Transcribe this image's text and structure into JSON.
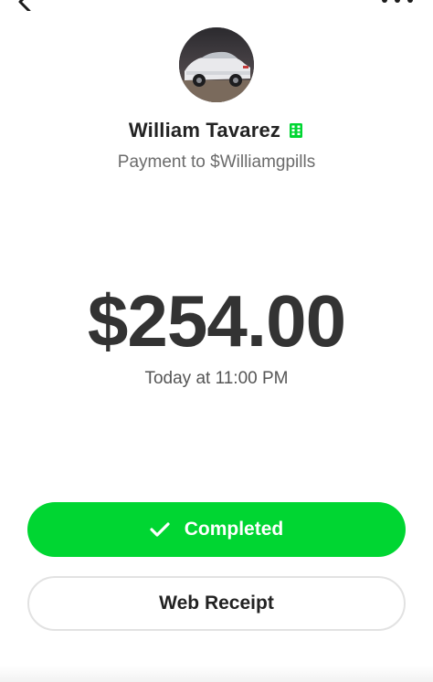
{
  "header": {
    "back_icon": "chevron-left-icon",
    "more_icon": "more-horizontal-icon"
  },
  "recipient": {
    "name": "William Tavarez",
    "badge_icon": "business-building-icon",
    "badge_color": "#00d632",
    "subtitle": "Payment to $Williamgpills",
    "avatar_icon": "car-photo-avatar"
  },
  "payment": {
    "amount": "$254.00",
    "timestamp": "Today at 11:00 PM"
  },
  "actions": {
    "status_label": "Completed",
    "status_icon": "checkmark-icon",
    "status_color": "#00d632",
    "receipt_label": "Web Receipt"
  }
}
